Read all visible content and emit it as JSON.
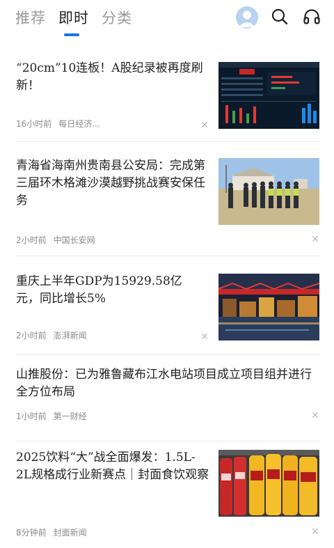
{
  "tabs": [
    {
      "label": "推荐",
      "active": false
    },
    {
      "label": "即时",
      "active": true
    },
    {
      "label": "分类",
      "active": false
    }
  ],
  "colors": {
    "accent": "#1a73e8",
    "meta": "#8a8a8a"
  },
  "icons": {
    "avatar": "user-avatar",
    "search": "search-icon",
    "headphones": "headphones-icon"
  },
  "feed": [
    {
      "title": "“20cm”10连板！A股纪录被再度刷新！",
      "time": "16小时前",
      "source": "每日经济...",
      "has_image": true,
      "image": "stock-market-screen"
    },
    {
      "title": "青海省海南州贵南县公安局：完成第三届环木格滩沙漠越野挑战赛安保任务",
      "time": "2小时前",
      "source": "中国长安网",
      "has_image": true,
      "image": "police-lineup-photo"
    },
    {
      "title": "重庆上半年GDP为15929.58亿元，同比增长5%",
      "time": "2小时前",
      "source": "澎湃新闻",
      "has_image": true,
      "image": "chongqing-night-photo"
    },
    {
      "title": "山推股份：已为雅鲁藏布江水电站项目成立项目组并进行全方位布局",
      "time": "1小时前",
      "source": "第一财经",
      "has_image": false
    },
    {
      "title": "2025饮料“大”战全面爆发：1.5L-2L规格成行业新赛点｜封面食饮观察",
      "time": "8分钟前",
      "source": "封面新闻",
      "has_image": true,
      "image": "beverage-shelf-photo"
    }
  ],
  "close_glyph": "✕"
}
